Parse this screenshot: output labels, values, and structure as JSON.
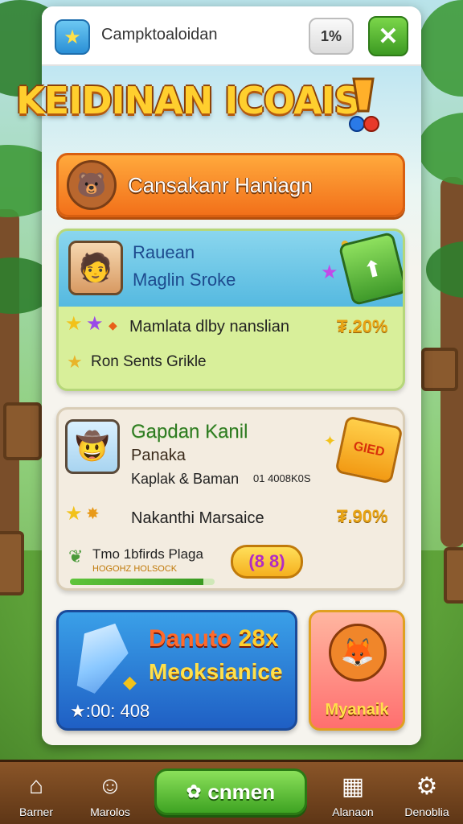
{
  "topbar": {
    "title": "Campktoaloidan",
    "percent": "1%",
    "close": "✕"
  },
  "headline": "KEIDINAN ICOAIS",
  "banner": {
    "text": "Cansakanr Haniagn"
  },
  "card1": {
    "name_line1": "Rauean",
    "name_line2": "Maglin Sroke",
    "row1_text": "Mamlata dlby nanslian",
    "row1_value": "₮.20%",
    "row2_text": "Ron Sents Grikle"
  },
  "card2": {
    "title": "Gapdan Kanil",
    "subtitle": "Panaka",
    "meta": "Kaplak & Baman",
    "meta_code": "01 4008K0S",
    "ticket_text": "GIED",
    "row1_text": "Nakanthi Marsaice",
    "row1_value": "₮.90%",
    "row2_text": "Tmo 1bfirds Plaga",
    "row2_sub": "HOGOHZ HOLSOCK",
    "badge": "(8 8)",
    "progress": 0.92
  },
  "tile_blue": {
    "title": "Danuto",
    "multiplier": "28x",
    "subtitle": "Meoksianice",
    "timer": "★:00: 408"
  },
  "tile_orange": {
    "label": "Myanaik"
  },
  "nav": {
    "items": [
      {
        "label": "Barner",
        "icon": "home-icon"
      },
      {
        "label": "Marolos",
        "icon": "profile-icon"
      },
      {
        "label": "Alanaon",
        "icon": "map-icon"
      },
      {
        "label": "Denoblia",
        "icon": "gear-icon"
      }
    ],
    "play_label": "cnmen"
  },
  "colors": {
    "panel": "#f6f4ee",
    "banner": "#f2701a",
    "accent_green": "#3ea322",
    "headline": "#ffcf2e",
    "nav": "#5e3616"
  }
}
